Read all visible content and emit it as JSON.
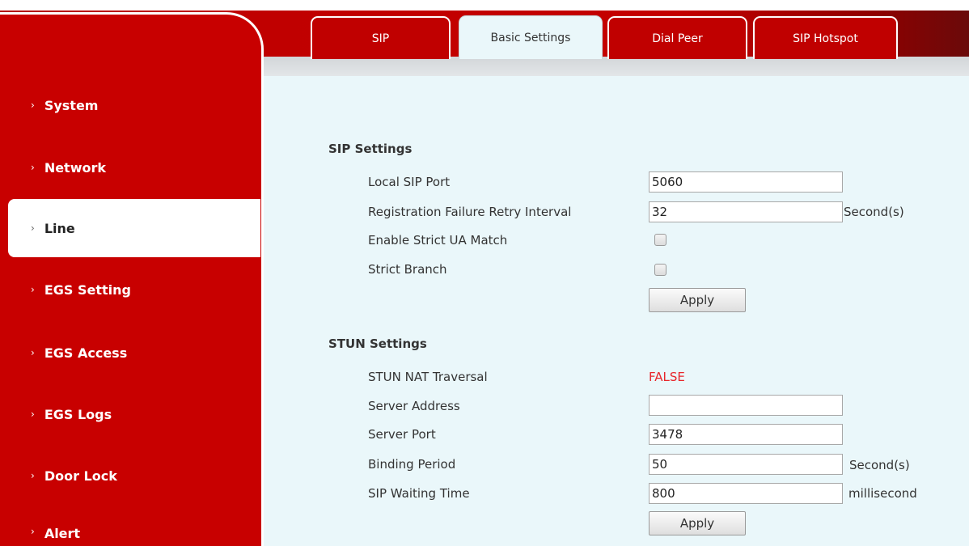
{
  "tabs": [
    {
      "label": "SIP"
    },
    {
      "label": "Basic Settings"
    },
    {
      "label": "Dial Peer"
    },
    {
      "label": "SIP Hotspot"
    }
  ],
  "active_tab": "Basic Settings",
  "sidebar": {
    "items": [
      {
        "label": "System"
      },
      {
        "label": "Network"
      },
      {
        "label": "Line"
      },
      {
        "label": "EGS Setting"
      },
      {
        "label": "EGS Access"
      },
      {
        "label": "EGS Logs"
      },
      {
        "label": "Door Lock"
      },
      {
        "label": "Alert"
      }
    ],
    "active": "Line",
    "chevron": "›"
  },
  "sip_settings": {
    "title": "SIP Settings",
    "local_sip_port": {
      "label": "Local SIP Port",
      "value": "5060"
    },
    "retry_interval": {
      "label": "Registration Failure Retry Interval",
      "value": "32",
      "unit": "Second(s)"
    },
    "strict_ua_match": {
      "label": "Enable Strict UA Match",
      "checked": false
    },
    "strict_branch": {
      "label": "Strict Branch",
      "checked": false
    },
    "apply_label": "Apply"
  },
  "stun_settings": {
    "title": "STUN Settings",
    "nat_traversal": {
      "label": "STUN NAT Traversal",
      "value": "FALSE"
    },
    "server_address": {
      "label": "Server Address",
      "value": ""
    },
    "server_port": {
      "label": "Server Port",
      "value": "3478"
    },
    "binding_period": {
      "label": "Binding Period",
      "value": "50",
      "unit": "Second(s)"
    },
    "sip_waiting_time": {
      "label": "SIP Waiting Time",
      "value": "800",
      "unit": "millisecond"
    },
    "apply_label": "Apply"
  },
  "colors": {
    "brand_red": "#c80000",
    "content_bg": "#eaf7fa",
    "false_red": "#e8262b"
  }
}
